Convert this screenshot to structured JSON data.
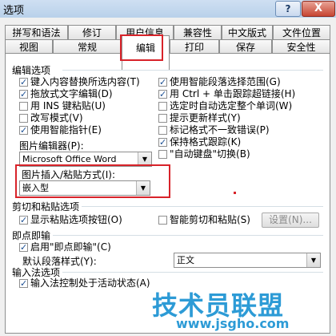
{
  "window": {
    "title": "选项",
    "help": "?",
    "close": "X"
  },
  "tabs_row1": [
    "拼写和语法",
    "修订",
    "用户信息",
    "兼容性",
    "中文版式",
    "文件位置"
  ],
  "tabs_row2": [
    "视图",
    "常规",
    "编辑",
    "打印",
    "保存",
    "安全性"
  ],
  "active_tab": "编辑",
  "edit_section": {
    "title": "编辑选项",
    "left": [
      {
        "label": "键入内容替换所选内容(T)",
        "checked": true
      },
      {
        "label": "拖放式文字编辑(D)",
        "checked": true
      },
      {
        "label": "用 INS 键粘贴(U)",
        "checked": false
      },
      {
        "label": "改写模式(V)",
        "checked": false
      },
      {
        "label": "使用智能指针(E)",
        "checked": true
      }
    ],
    "right": [
      {
        "label": "使用智能段落选择范围(G)",
        "checked": true
      },
      {
        "label": "用 Ctrl + 单击跟踪超链接(H)",
        "checked": true
      },
      {
        "label": "选定时自动选定整个单词(W)",
        "checked": false
      },
      {
        "label": "提示更新样式(Y)",
        "checked": false
      },
      {
        "label": "标记格式不一致错误(P)",
        "checked": false
      },
      {
        "label": "保持格式跟踪(K)",
        "checked": true
      },
      {
        "label": "\"自动键盘\"切换(B)",
        "checked": false
      }
    ],
    "picture_editor_label": "图片编辑器(P):",
    "picture_editor_value": "Microsoft Office Word",
    "insert_paste_label": "图片插入/粘贴方式(I):",
    "insert_paste_value": "嵌入型"
  },
  "cut_paste": {
    "title": "剪切和粘贴选项",
    "show_paste_btn": {
      "label": "显示粘贴选项按钮(O)",
      "checked": true
    },
    "smart_cut": {
      "label": "智能剪切和粘贴(S)",
      "checked": false
    },
    "settings_button": "设置(N)..."
  },
  "click_type": {
    "title": "即点即输",
    "enable": {
      "label": "启用\"即点即输\"(C)",
      "checked": true
    },
    "default_style_label": "默认段落样式(Y):",
    "default_style_value": "正文"
  },
  "ime": {
    "title": "输入法选项",
    "control": {
      "label": "输入法控制处于活动状态(A)",
      "checked": true
    }
  },
  "watermark": {
    "logo": "技术员联盟",
    "url": "www.jsgho.com"
  },
  "colors": {
    "highlight": "#d8232a",
    "watermark": "#2d9bd6"
  }
}
